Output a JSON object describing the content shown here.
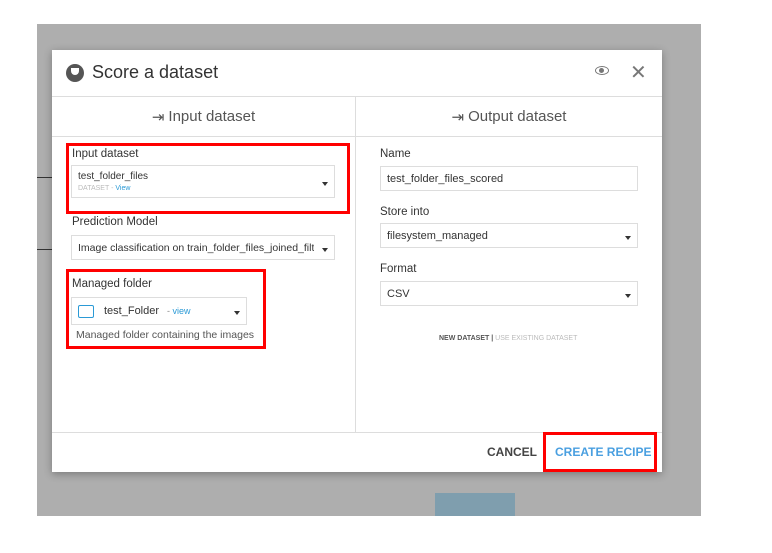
{
  "dialog": {
    "title": "Score a dataset",
    "icon": "trophy-icon"
  },
  "input": {
    "header": "Input dataset",
    "dataset_label": "Input dataset",
    "dataset_value": "test_folder_files",
    "dataset_type": "DATASET",
    "view": "View",
    "model_label": "Prediction Model",
    "model_value": "Image classification on train_folder_files_joined_filt",
    "folder_label": "Managed folder",
    "folder_value": "test_Folder",
    "folder_view": "view",
    "folder_help": "Managed folder containing the images"
  },
  "output": {
    "header": "Output dataset",
    "name_label": "Name",
    "name_value": "test_folder_files_scored",
    "store_label": "Store into",
    "store_value": "filesystem_managed",
    "format_label": "Format",
    "format_value": "CSV",
    "new_dataset": "NEW DATASET",
    "use_existing": "USE EXISTING DATASET"
  },
  "footer": {
    "cancel": "CANCEL",
    "create": "CREATE RECIPE"
  },
  "colors": {
    "accent": "#2b9ad6",
    "highlight": "#ff0000"
  }
}
